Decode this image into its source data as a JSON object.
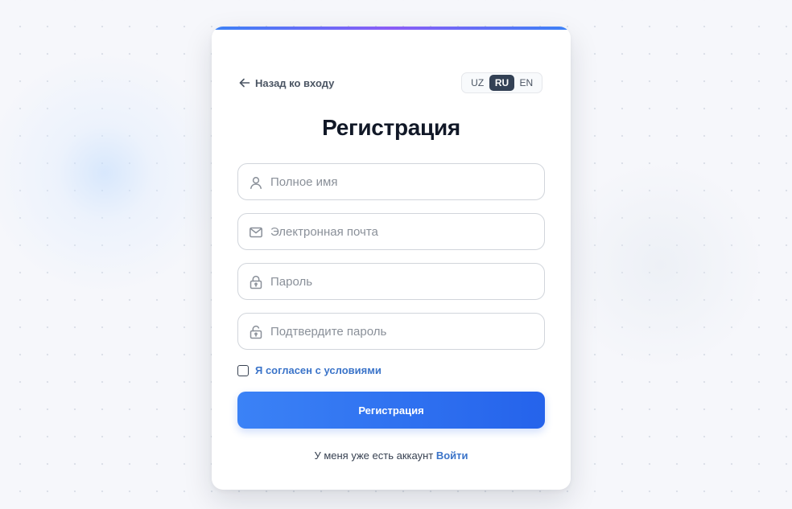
{
  "nav": {
    "back_label": "Назад ко входу"
  },
  "language": {
    "options": [
      "UZ",
      "RU",
      "EN"
    ],
    "selected": "RU"
  },
  "form": {
    "title": "Регистрация",
    "fields": {
      "full_name": {
        "placeholder": "Полное имя",
        "value": ""
      },
      "email": {
        "placeholder": "Электронная почта",
        "value": ""
      },
      "password": {
        "placeholder": "Пароль",
        "value": ""
      },
      "confirm_password": {
        "placeholder": "Подтвердите пароль",
        "value": ""
      }
    },
    "terms": {
      "label": "Я согласен с условиями",
      "checked": false
    },
    "submit_label": "Регистрация"
  },
  "footer": {
    "prompt": "У меня уже есть аккаунт",
    "login_label": "Войти"
  },
  "colors": {
    "accent": "#3b82f6",
    "accent_dark": "#2563eb",
    "link": "#3b74c9",
    "title": "#111827",
    "lang_active_bg": "#334155"
  },
  "icons": {
    "back": "arrow-left-icon",
    "full_name": "user-icon",
    "email": "mail-icon",
    "password": "lock-icon",
    "confirm_password": "lock-open-icon"
  }
}
